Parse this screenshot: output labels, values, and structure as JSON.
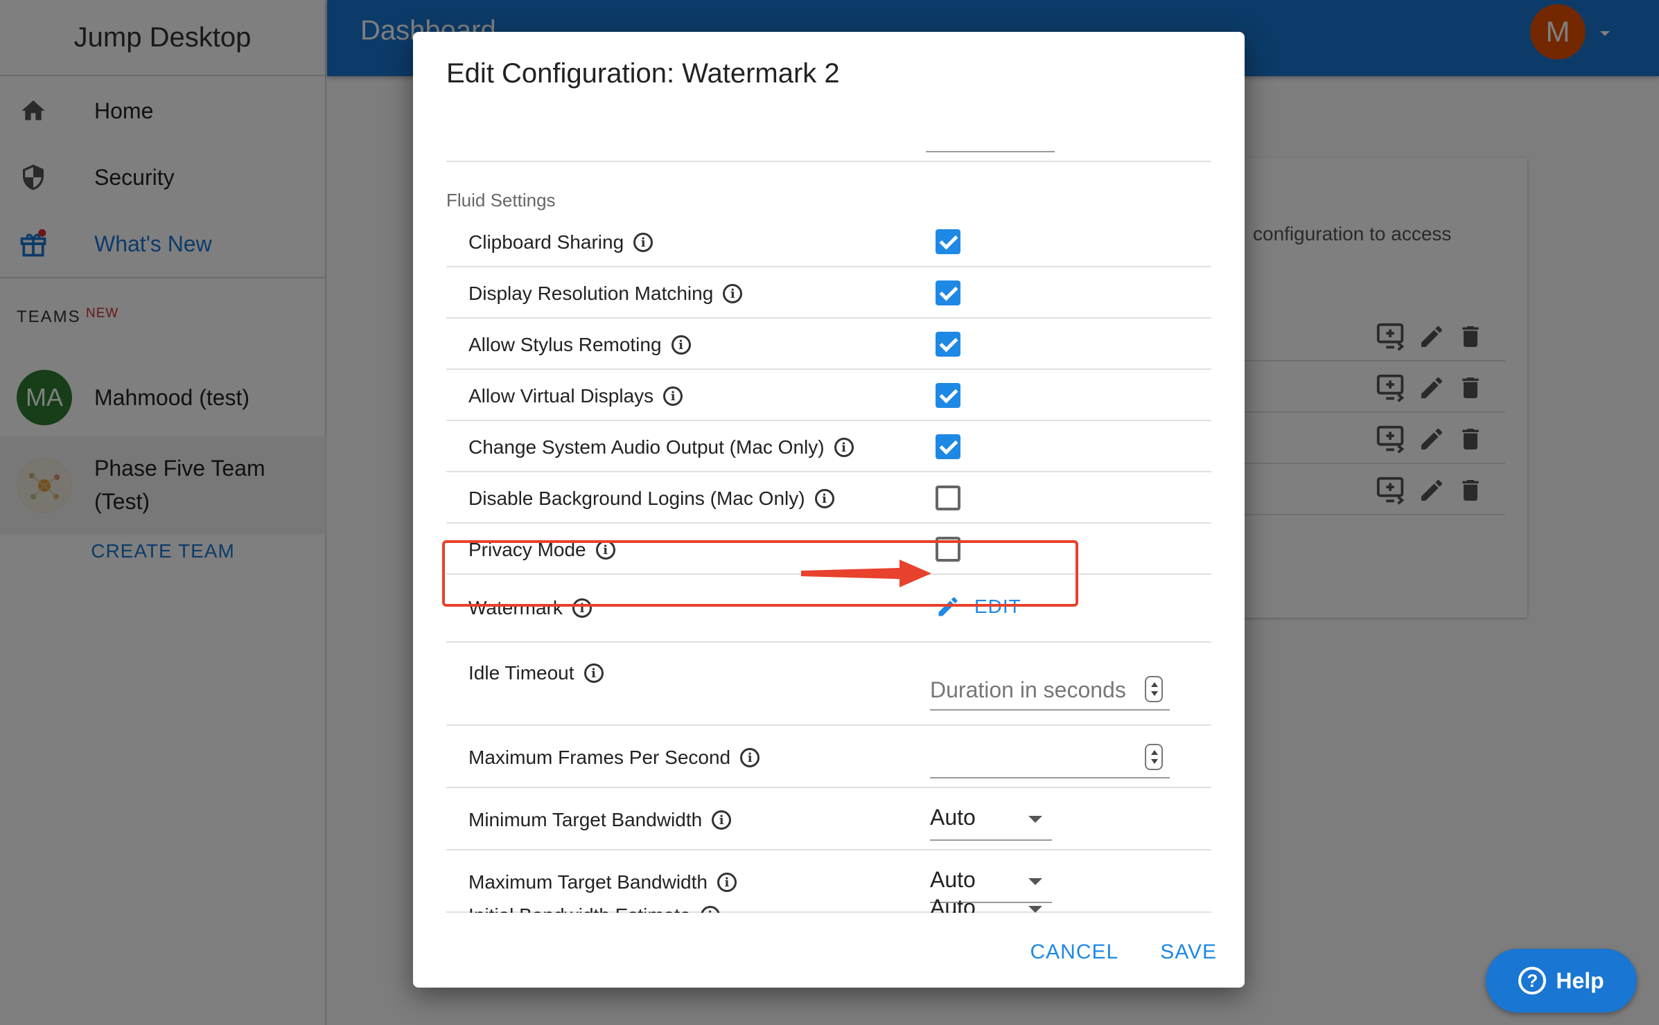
{
  "app": {
    "title": "Jump Desktop"
  },
  "sidebar": {
    "items": [
      {
        "label": "Home",
        "icon": "home-icon"
      },
      {
        "label": "Security",
        "icon": "shield-icon"
      },
      {
        "label": "What's New",
        "icon": "gift-icon",
        "has_badge": true
      }
    ],
    "teams_heading": "TEAMS",
    "teams_badge": "NEW",
    "teams": [
      {
        "initials": "MA",
        "name": "Mahmood (test)",
        "avatar_color": "#2e7d32"
      },
      {
        "name_line1": "Phase Five Team",
        "name_line2": "(Test)",
        "selected": true
      }
    ],
    "create_team": "CREATE TEAM"
  },
  "topbar": {
    "title": "Dashboard",
    "user_initial": "M",
    "accent": "#1976d2",
    "avatar_color": "#e65100"
  },
  "background_card": {
    "text": "configuration to access",
    "rows": 4,
    "actions": [
      "monitor-add-icon",
      "pencil-icon",
      "trash-icon"
    ]
  },
  "dialog": {
    "title": "Edit Configuration: Watermark 2",
    "section_label": "Fluid Settings",
    "checkbox_settings": [
      {
        "label": "Clipboard Sharing",
        "checked": true
      },
      {
        "label": "Display Resolution Matching",
        "checked": true
      },
      {
        "label": "Allow Stylus Remoting",
        "checked": true
      },
      {
        "label": "Allow Virtual Displays",
        "checked": true
      },
      {
        "label": "Change System Audio Output (Mac Only)",
        "checked": true
      },
      {
        "label": "Disable Background Logins (Mac Only)",
        "checked": false
      },
      {
        "label": "Privacy Mode",
        "checked": false
      }
    ],
    "watermark": {
      "label": "Watermark",
      "edit_label": "EDIT"
    },
    "idle_timeout": {
      "label": "Idle Timeout",
      "placeholder": "Duration in seconds",
      "value": ""
    },
    "max_fps": {
      "label": "Maximum Frames Per Second",
      "value": ""
    },
    "selects": [
      {
        "label": "Minimum Target Bandwidth",
        "value": "Auto"
      },
      {
        "label": "Maximum Target Bandwidth",
        "value": "Auto"
      },
      {
        "label": "Initial Bandwidth Estimate",
        "value": "Auto"
      }
    ],
    "actions": {
      "cancel": "CANCEL",
      "save": "SAVE"
    }
  },
  "help_button": {
    "label": "Help"
  },
  "annotation": {
    "color": "#e8412c"
  }
}
